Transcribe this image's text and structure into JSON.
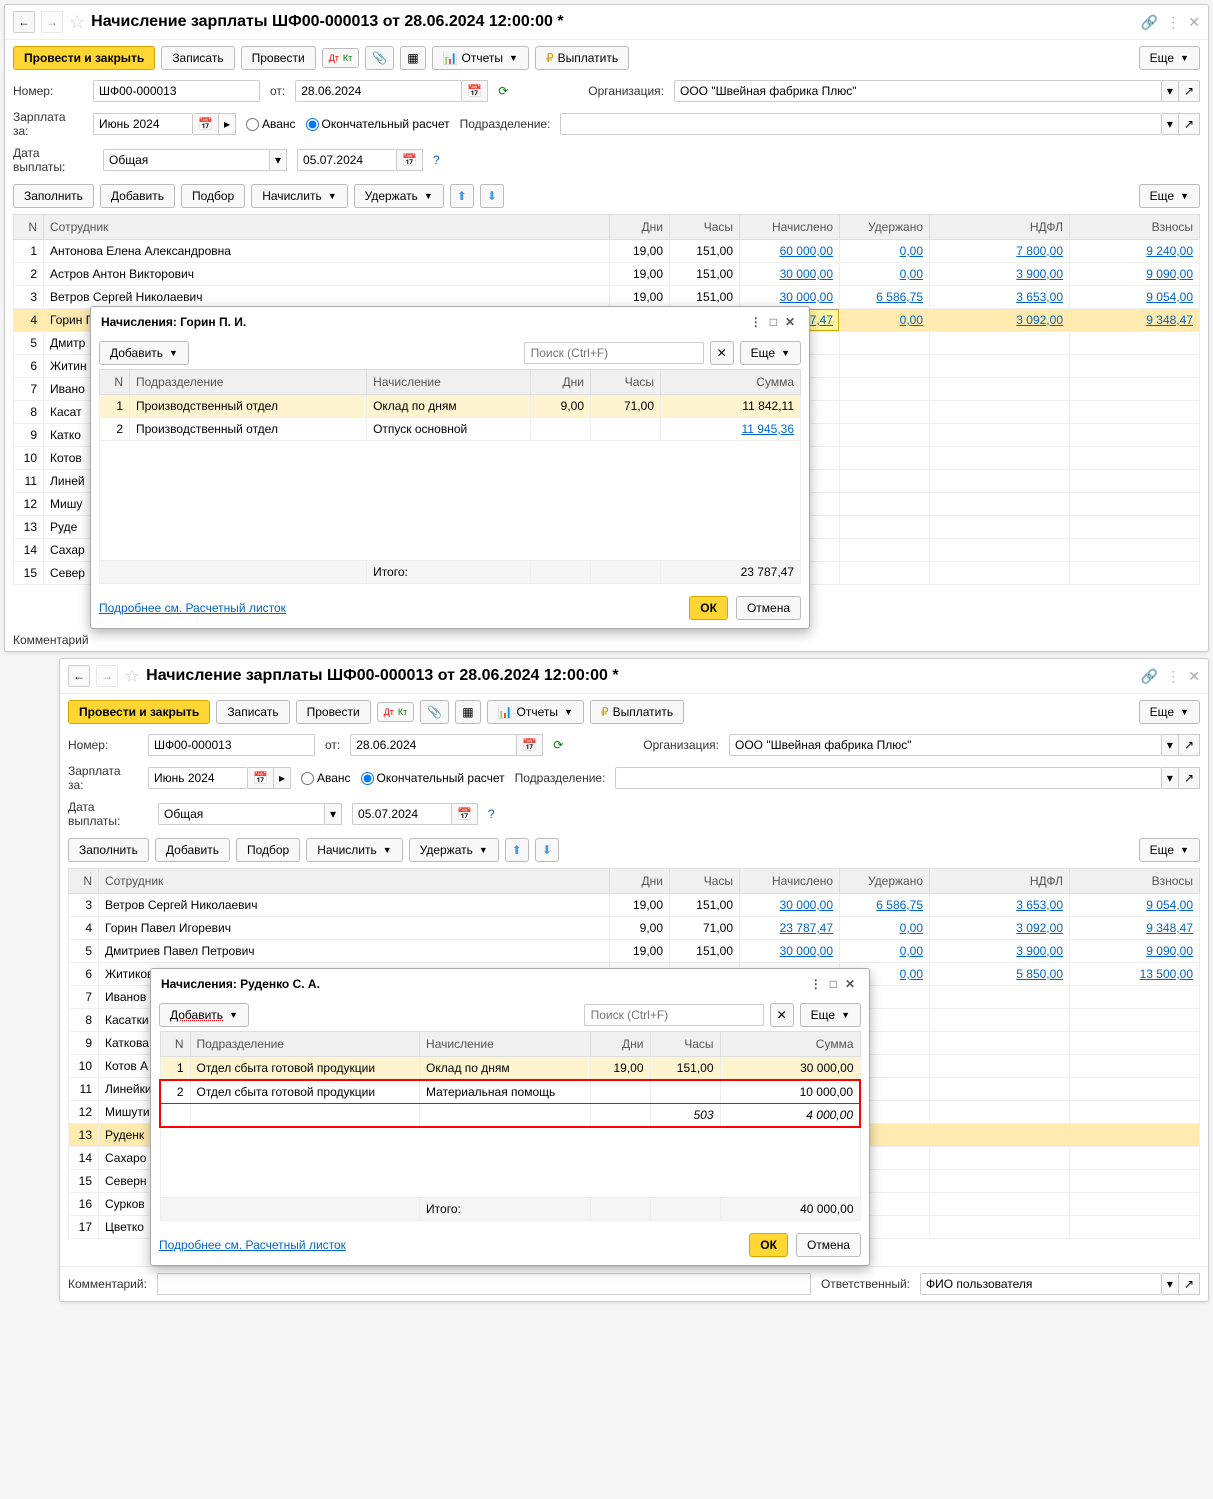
{
  "win1": {
    "title": "Начисление зарплаты ШФ00-000013 от 28.06.2024 12:00:00 *",
    "toolbar": {
      "post_close": "Провести и закрыть",
      "write": "Записать",
      "post": "Провести",
      "reports": "Отчеты",
      "pay": "Выплатить",
      "more": "Еще"
    },
    "labels": {
      "number": "Номер:",
      "from": "от:",
      "org": "Организация:",
      "salary_for": "Зарплата за:",
      "advance": "Аванс",
      "final": "Окончательный расчет",
      "dept": "Подразделение:",
      "pay_date": "Дата выплаты:",
      "fill": "Заполнить",
      "add": "Добавить",
      "pick": "Подбор",
      "accrue": "Начислить",
      "deduct": "Удержать",
      "comment": "Комментарий"
    },
    "vals": {
      "number": "ШФ00-000013",
      "date": "28.06.2024",
      "org": "ООО \"Швейная фабрика Плюс\"",
      "month": "Июнь 2024",
      "pay_type": "Общая",
      "pay_date": "05.07.2024"
    },
    "cols": {
      "n": "N",
      "emp": "Сотрудник",
      "days": "Дни",
      "hours": "Часы",
      "accrued": "Начислено",
      "deducted": "Удержано",
      "ndfl": "НДФЛ",
      "contrib": "Взносы"
    },
    "rows": [
      {
        "n": "1",
        "emp": "Антонова Елена Александровна",
        "d": "19,00",
        "h": "151,00",
        "acc": "60 000,00",
        "ded": "0,00",
        "ndfl": "7 800,00",
        "con": "9 240,00"
      },
      {
        "n": "2",
        "emp": "Астров Антон Викторович",
        "d": "19,00",
        "h": "151,00",
        "acc": "30 000,00",
        "ded": "0,00",
        "ndfl": "3 900,00",
        "con": "9 090,00"
      },
      {
        "n": "3",
        "emp": "Ветров Сергей Николаевич",
        "d": "19,00",
        "h": "151,00",
        "acc": "30 000,00",
        "ded": "6 586,75",
        "ndfl": "3 653,00",
        "con": "9 054,00"
      },
      {
        "n": "4",
        "emp": "Горин Павел Игоревич",
        "d": "9,00",
        "h": "71,00",
        "acc": "23 787,47",
        "ded": "0,00",
        "ndfl": "3 092,00",
        "con": "9 348,47"
      },
      {
        "n": "5",
        "emp": "Дмитр"
      },
      {
        "n": "6",
        "emp": "Житин"
      },
      {
        "n": "7",
        "emp": "Ивано"
      },
      {
        "n": "8",
        "emp": "Касат"
      },
      {
        "n": "9",
        "emp": "Катко"
      },
      {
        "n": "10",
        "emp": "Котов"
      },
      {
        "n": "11",
        "emp": "Линей"
      },
      {
        "n": "12",
        "emp": "Мишу"
      },
      {
        "n": "13",
        "emp": "Руде"
      },
      {
        "n": "14",
        "emp": "Сахар"
      },
      {
        "n": "15",
        "emp": "Север"
      }
    ]
  },
  "popup1": {
    "title": "Начисления: Горин П. И.",
    "add": "Добавить",
    "search_ph": "Поиск (Ctrl+F)",
    "more": "Еще",
    "cols": {
      "n": "N",
      "dept": "Подразделение",
      "accrual": "Начисление",
      "days": "Дни",
      "hours": "Часы",
      "sum": "Сумма"
    },
    "rows": [
      {
        "n": "1",
        "dept": "Производственный отдел",
        "acc": "Оклад по дням",
        "d": "9,00",
        "h": "71,00",
        "s": "11 842,11"
      },
      {
        "n": "2",
        "dept": "Производственный отдел",
        "acc": "Отпуск основной",
        "d": "",
        "h": "",
        "s": "11 945,36"
      }
    ],
    "total_lbl": "Итого:",
    "total": "23 787,47",
    "detail": "Подробнее см. Расчетный листок",
    "ok": "ОК",
    "cancel": "Отмена"
  },
  "win2": {
    "title": "Начисление зарплаты ШФ00-000013 от 28.06.2024 12:00:00 *",
    "rows": [
      {
        "n": "3",
        "emp": "Ветров Сергей Николаевич",
        "d": "19,00",
        "h": "151,00",
        "acc": "30 000,00",
        "ded": "6 586,75",
        "ndfl": "3 653,00",
        "con": "9 054,00"
      },
      {
        "n": "4",
        "emp": "Горин Павел Игоревич",
        "d": "9,00",
        "h": "71,00",
        "acc": "23 787,47",
        "ded": "0,00",
        "ndfl": "3 092,00",
        "con": "9 348,47"
      },
      {
        "n": "5",
        "emp": "Дмитриев Павел Петрович",
        "d": "19,00",
        "h": "151,00",
        "acc": "30 000,00",
        "ded": "0,00",
        "ndfl": "3 900,00",
        "con": "9 090,00"
      },
      {
        "n": "6",
        "emp": "Житиков Артем Михайлович",
        "d": "",
        "h": "",
        "acc": "45 000,00",
        "ded": "0,00",
        "ndfl": "5 850,00",
        "con": "13 500,00"
      },
      {
        "n": "7",
        "emp": "Иванов"
      },
      {
        "n": "8",
        "emp": "Касатки"
      },
      {
        "n": "9",
        "emp": "Каткова"
      },
      {
        "n": "10",
        "emp": "Котов А"
      },
      {
        "n": "11",
        "emp": "Линейки"
      },
      {
        "n": "12",
        "emp": "Мишути"
      },
      {
        "n": "13",
        "emp": "Руденк"
      },
      {
        "n": "14",
        "emp": "Сахаро"
      },
      {
        "n": "15",
        "emp": "Северн"
      },
      {
        "n": "16",
        "emp": "Сурков"
      },
      {
        "n": "17",
        "emp": "Цветко"
      }
    ],
    "labels": {
      "comment": "Комментарий:",
      "responsible": "Ответственный:",
      "resp_val": "ФИО пользователя"
    }
  },
  "popup2": {
    "title": "Начисления: Руденко С. А.",
    "add": "Добавить",
    "search_ph": "Поиск (Ctrl+F)",
    "more": "Еще",
    "cols": {
      "n": "N",
      "dept": "Подразделение",
      "accrual": "Начисление",
      "days": "Дни",
      "hours": "Часы",
      "sum": "Сумма"
    },
    "rows": [
      {
        "n": "1",
        "dept": "Отдел сбыта готовой продукции",
        "acc": "Оклад по дням",
        "d": "19,00",
        "h": "151,00",
        "s": "30 000,00"
      },
      {
        "n": "2",
        "dept": "Отдел сбыта готовой продукции",
        "acc": "Материальная помощь",
        "d": "",
        "h": "",
        "s": "10 000,00"
      },
      {
        "n": "",
        "dept": "",
        "acc": "",
        "d": "",
        "h": "503",
        "s": "4 000,00",
        "italic": true
      }
    ],
    "total_lbl": "Итого:",
    "total": "40 000,00",
    "detail": "Подробнее см. Расчетный листок",
    "ok": "ОК",
    "cancel": "Отмена"
  }
}
